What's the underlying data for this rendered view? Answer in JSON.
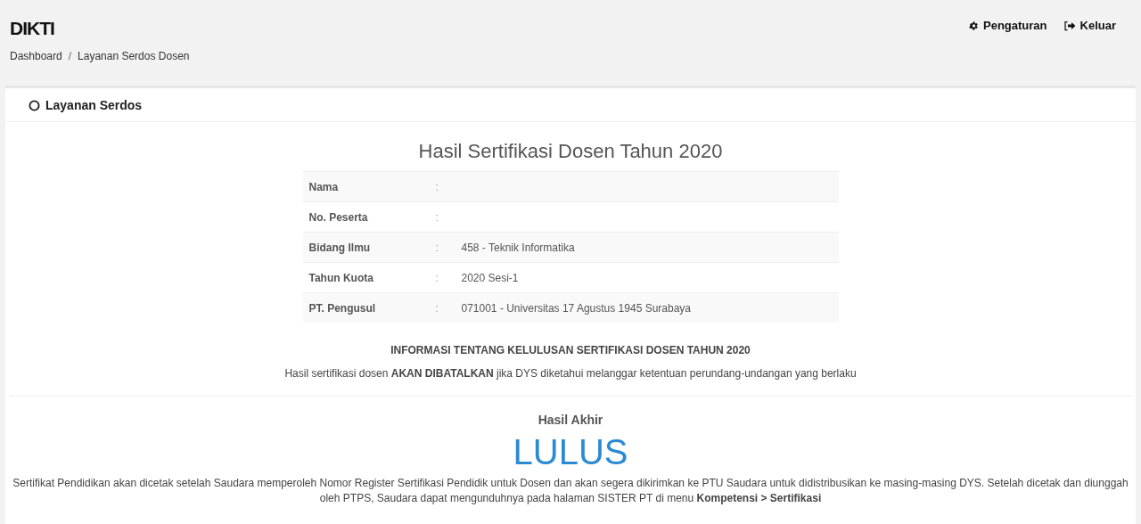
{
  "header": {
    "brand": "DIKTI",
    "menu": [
      {
        "kind": "settings",
        "label": "Pengaturan"
      },
      {
        "kind": "logout",
        "label": "Keluar"
      }
    ]
  },
  "breadcrumb": [
    "Dashboard",
    "Layanan Serdos Dosen"
  ],
  "breadcrumb_separator": "/",
  "card": {
    "title": "Layanan Serdos"
  },
  "result_title": "Hasil Sertifikasi Dosen Tahun 2020",
  "details": [
    {
      "label": "Nama",
      "separator": ":"
    },
    {
      "label": "No. Peserta",
      "separator": ":"
    },
    {
      "label": "Bidang Ilmu",
      "separator": ":",
      "value": "458 - Teknik Informatika"
    },
    {
      "label": "Tahun Kuota",
      "separator": ":",
      "value": "2020 Sesi-1"
    },
    {
      "label": "PT. Pengusul",
      "separator": ":",
      "value": "071001 - Universitas 17 Agustus 1945 Surabaya"
    }
  ],
  "info_heading": "INFORMASI TENTANG KELULUSAN SERTIFIKASI DOSEN TAHUN 2020",
  "info_text": "Hasil sertifikasi dosen **AKAN DIBATALKAN** jika DYS diketahui melanggar ketentuan perundang-undangan yang berlaku",
  "final": {
    "label": "Hasil Akhir",
    "result": "LULUS",
    "note": "Sertifikat Pendidikan akan dicetak setelah Saudara memperoleh Nomor Register Sertifikasi Pendidik untuk Dosen dan akan segera dikirimkan ke PTU Saudara untuk didistribusikan ke masing-masing DYS. Setelah dicetak dan diunggah oleh PTPS, Saudara dapat mengunduhnya pada halaman SISTER PT di menu **Kompetensi > Sertifikasi**"
  }
}
